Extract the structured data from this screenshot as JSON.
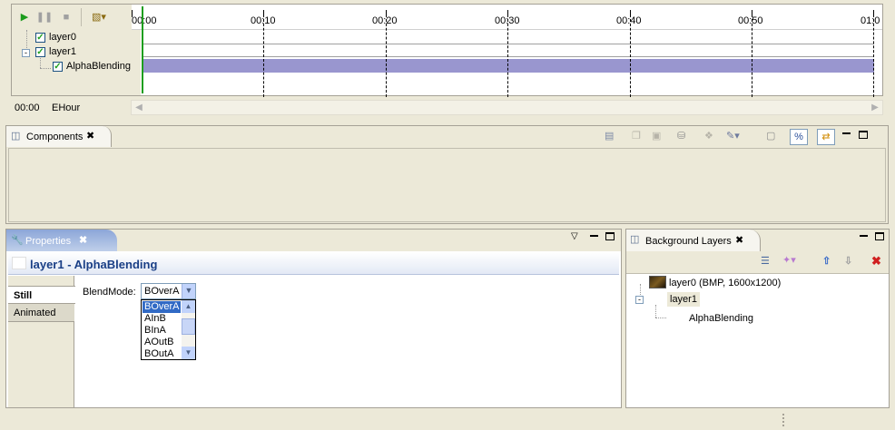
{
  "timeline": {
    "play_icon": "play-icon",
    "pause_icon": "pause-icon",
    "stop_icon": "stop-icon",
    "layers": [
      {
        "label": "layer0",
        "checked": true
      },
      {
        "label": "layer1",
        "checked": true
      },
      {
        "label": "AlphaBlending",
        "checked": true
      }
    ],
    "ticks": [
      "00:00",
      "00:10",
      "00:20",
      "00:30",
      "00:40",
      "00:50",
      "01:0"
    ],
    "time_display": "00:00",
    "unit_label": "EHour",
    "track_color": "#9996cf",
    "cursor_color": "#1d9e1d"
  },
  "components": {
    "tab_label": "Components"
  },
  "properties": {
    "tab_label": "Properties",
    "header_title": "layer1 - AlphaBlending",
    "side_tabs": [
      "Still",
      "Animated"
    ],
    "field_label": "BlendMode:",
    "field_value": "BOverA",
    "dropdown_options": [
      "BOverA",
      "AInB",
      "BInA",
      "AOutB",
      "BOutA"
    ],
    "header_accent": "#1a3f86"
  },
  "background_layers": {
    "tab_label": "Background Layers",
    "items": [
      {
        "label": "layer0 (BMP, 1600x1200)"
      },
      {
        "label": "layer1"
      },
      {
        "label": "AlphaBlending"
      }
    ]
  }
}
